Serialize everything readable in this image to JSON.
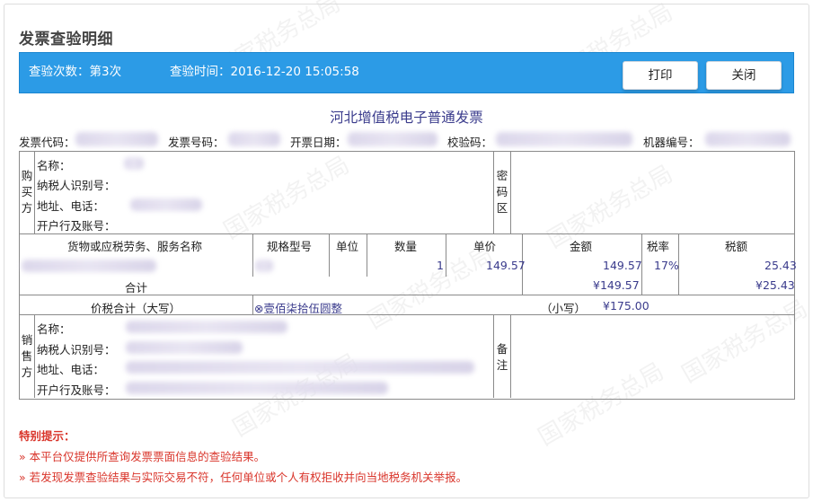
{
  "page_title": "发票查验明细",
  "bar": {
    "check_count": "查验次数：第3次",
    "check_time": "查验时间：2016-12-20 15:05:58",
    "print_label": "打印",
    "close_label": "关闭"
  },
  "invoice": {
    "title": "河北增值税电子普通发票",
    "meta": {
      "code_label": "发票代码：",
      "number_label": "发票号码：",
      "date_label": "开票日期：",
      "check_code_label": "校验码：",
      "machine_label": "机器编号："
    },
    "buyer": {
      "side_label": "购买方",
      "name_label": "名称：",
      "tax_id_label": "纳税人识别号：",
      "addr_label": "地址、电话：",
      "bank_label": "开户行及账号：",
      "cipher_label": "密码区"
    },
    "items": {
      "headers": [
        "货物或应税劳务、服务名称",
        "规格型号",
        "单位",
        "数量",
        "单价",
        "金额",
        "税率",
        "税额"
      ],
      "rows": [
        {
          "quantity": "1",
          "unit_price": "149.57",
          "amount": "149.57",
          "tax_rate": "17%",
          "tax": "25.43"
        }
      ],
      "total_label": "合计",
      "total_amount": "¥149.57",
      "total_tax": "¥25.43"
    },
    "grand_total": {
      "label": "价税合计（大写）",
      "upper": "⊗壹佰柒拾伍圆整",
      "lower_label": "（小写）",
      "lower": "¥175.00"
    },
    "seller": {
      "side_label": "销售方",
      "name_label": "名称：",
      "tax_id_label": "纳税人识别号：",
      "addr_label": "地址、电话：",
      "bank_label": "开户行及账号：",
      "remark_label": "备注"
    }
  },
  "notice": {
    "title": "特别提示：",
    "lines": [
      "» 本平台仅提供所查询发票票面信息的查验结果。",
      "» 若发现发票查验结果与实际交易不符，任何单位或个人有权拒收并向当地税务机关举报。"
    ]
  },
  "watermark": "国家税务总局"
}
